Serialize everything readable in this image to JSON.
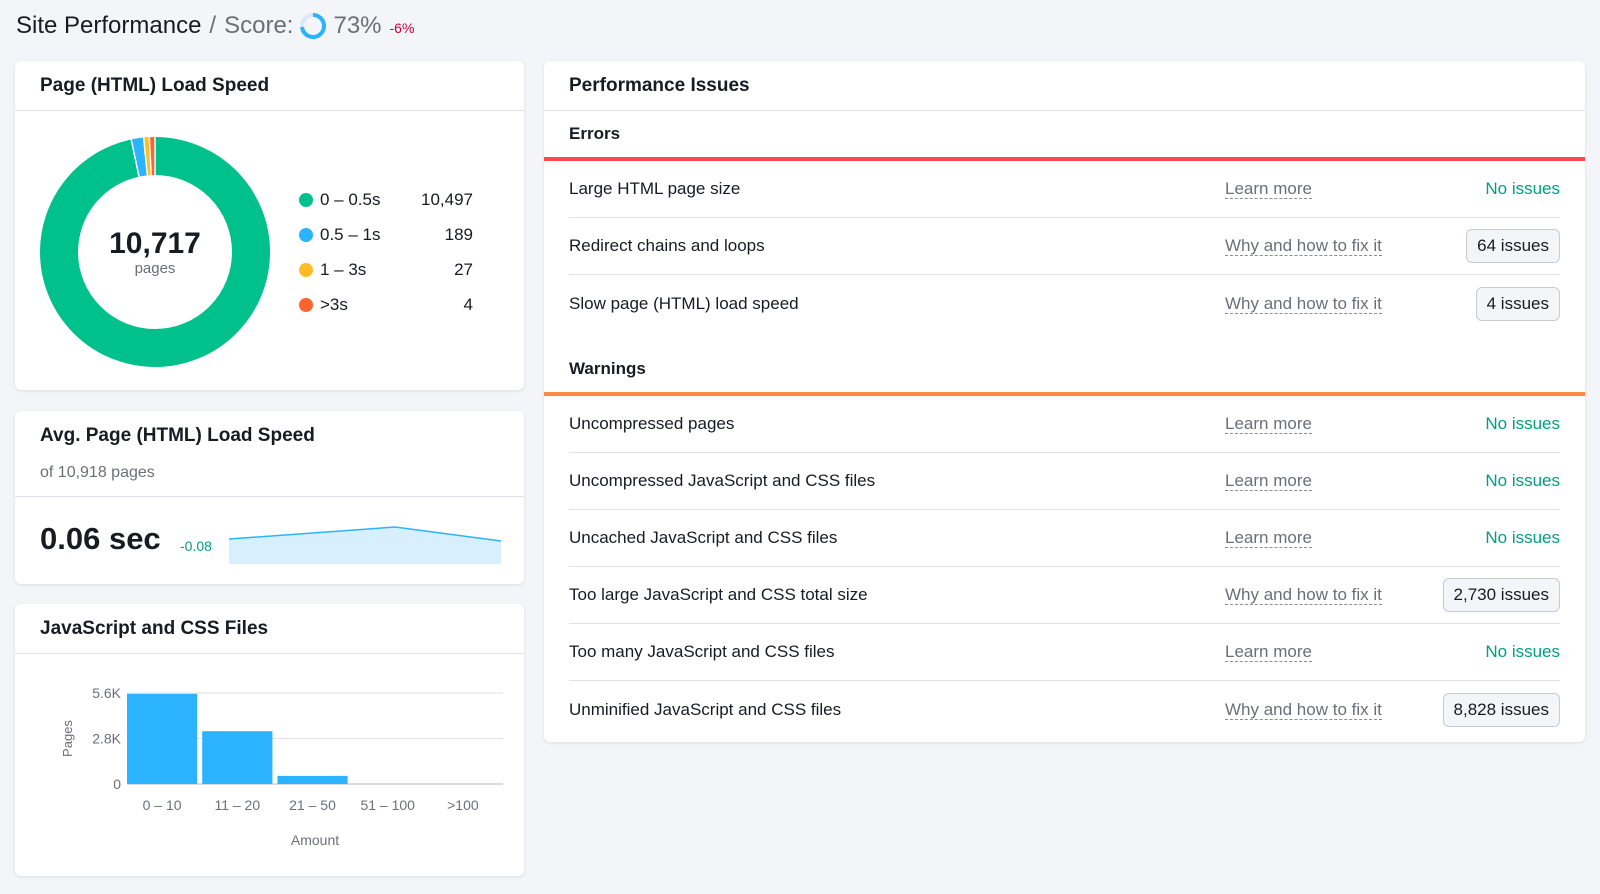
{
  "header": {
    "title": "Site Performance",
    "separator": "/",
    "score_label": "Score:",
    "score_value": "73%",
    "score_delta": "-6%",
    "score_fraction": 0.73
  },
  "load_speed": {
    "title": "Page (HTML) Load Speed",
    "total": "10,717",
    "unit": "pages",
    "legend": [
      {
        "label": "0 – 0.5s",
        "value": "10,497",
        "color": "#00c08b"
      },
      {
        "label": "0.5 – 1s",
        "value": "189",
        "color": "#2bb3ff"
      },
      {
        "label": "1 – 3s",
        "value": "27",
        "color": "#ffbc26"
      },
      {
        "label": ">3s",
        "value": "4",
        "color": "#ff642d"
      }
    ]
  },
  "avg_speed": {
    "title": "Avg. Page (HTML) Load Speed",
    "subtitle": "of 10,918 pages",
    "value": "0.06 sec",
    "delta": "-0.08"
  },
  "js_css": {
    "title": "JavaScript and CSS Files",
    "chart_data": {
      "type": "bar",
      "categories": [
        "0 – 10",
        "11 – 20",
        "21 – 50",
        "51 – 100",
        ">100"
      ],
      "values": [
        5550,
        3250,
        500,
        0,
        0
      ],
      "ylabel": "Pages",
      "xlabel": "Amount",
      "yticks": [
        "0",
        "2.8K",
        "5.6K"
      ],
      "ylim": [
        0,
        5600
      ],
      "color": "#2bb3ff"
    }
  },
  "issues": {
    "title": "Performance Issues",
    "errors_title": "Errors",
    "warnings_title": "Warnings",
    "errors": [
      {
        "name": "Large HTML page size",
        "link": "Learn more",
        "status": "No issues"
      },
      {
        "name": "Redirect chains and loops",
        "link": "Why and how to fix it",
        "status": "64 issues"
      },
      {
        "name": "Slow page (HTML) load speed",
        "link": "Why and how to fix it",
        "status": "4 issues"
      }
    ],
    "warnings": [
      {
        "name": "Uncompressed pages",
        "link": "Learn more",
        "status": "No issues"
      },
      {
        "name": "Uncompressed JavaScript and CSS files",
        "link": "Learn more",
        "status": "No issues"
      },
      {
        "name": "Uncached JavaScript and CSS files",
        "link": "Learn more",
        "status": "No issues"
      },
      {
        "name": "Too large JavaScript and CSS total size",
        "link": "Why and how to fix it",
        "status": "2,730 issues"
      },
      {
        "name": "Too many JavaScript and CSS files",
        "link": "Learn more",
        "status": "No issues"
      },
      {
        "name": "Unminified JavaScript and CSS files",
        "link": "Why and how to fix it",
        "status": "8,828 issues"
      }
    ]
  }
}
